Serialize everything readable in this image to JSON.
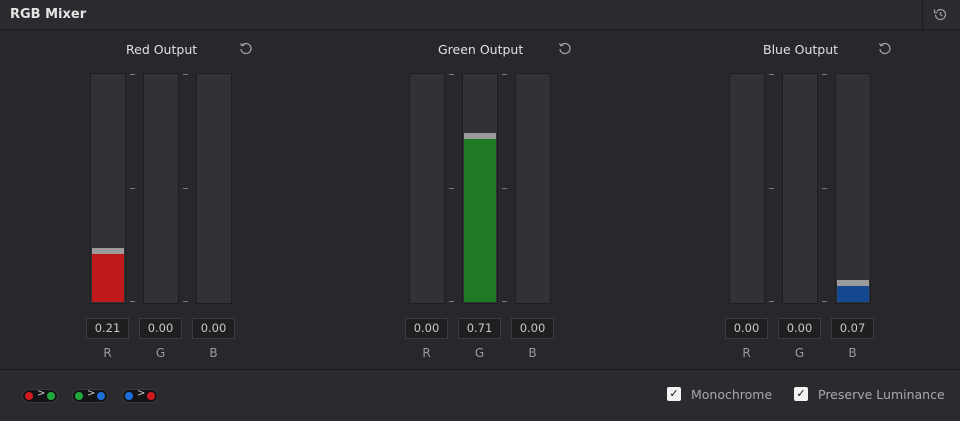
{
  "panel": {
    "title": "RGB Mixer",
    "reset_icon": "reset-icon"
  },
  "groups": [
    {
      "title": "Red Output",
      "channels": [
        {
          "label": "R",
          "value": "0.21",
          "level": 0.21,
          "color": "#c0191b"
        },
        {
          "label": "G",
          "value": "0.00",
          "level": 0.0,
          "color": "#1f7a24"
        },
        {
          "label": "B",
          "value": "0.00",
          "level": 0.0,
          "color": "#14498f"
        }
      ]
    },
    {
      "title": "Green Output",
      "channels": [
        {
          "label": "R",
          "value": "0.00",
          "level": 0.0,
          "color": "#c0191b"
        },
        {
          "label": "G",
          "value": "0.71",
          "level": 0.71,
          "color": "#1f7a24"
        },
        {
          "label": "B",
          "value": "0.00",
          "level": 0.0,
          "color": "#14498f"
        }
      ]
    },
    {
      "title": "Blue Output",
      "channels": [
        {
          "label": "R",
          "value": "0.00",
          "level": 0.0,
          "color": "#c0191b"
        },
        {
          "label": "G",
          "value": "0.00",
          "level": 0.0,
          "color": "#1f7a24"
        },
        {
          "label": "B",
          "value": "0.07",
          "level": 0.07,
          "color": "#14498f"
        }
      ]
    }
  ],
  "presets": [
    {
      "name": "swap-red-green-preset",
      "from": "#d11a1f",
      "to": "#22a83a"
    },
    {
      "name": "swap-green-blue-preset",
      "from": "#22a83a",
      "to": "#1e6fd9"
    },
    {
      "name": "swap-blue-red-preset",
      "from": "#1e6fd9",
      "to": "#d11a1f"
    }
  ],
  "footer": {
    "monochrome_label": "Monochrome",
    "monochrome_checked": true,
    "preserve_luminance_label": "Preserve Luminance",
    "preserve_luminance_checked": true
  }
}
